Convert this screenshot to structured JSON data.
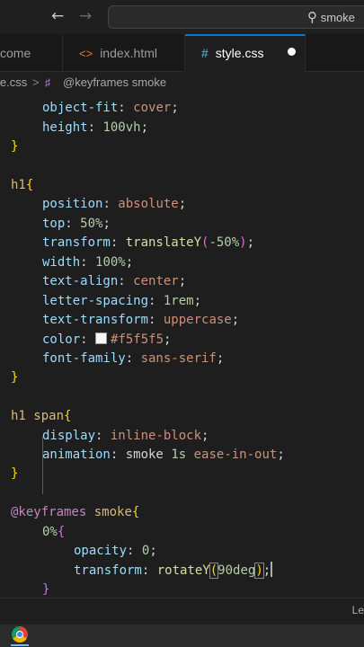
{
  "titlebar": {
    "search_text": "smoke"
  },
  "tabs": [
    {
      "label": "come"
    },
    {
      "label": "index.html",
      "icon": "html-file-icon"
    },
    {
      "label": "style.css",
      "icon": "css-file-icon",
      "active": true,
      "unsaved": true
    }
  ],
  "breadcrumb": {
    "file": "le.css",
    "separator": ">",
    "symbol": "@keyframes smoke"
  },
  "code": {
    "l1_prop": "object-fit",
    "l1_val": "cover",
    "l2_prop": "height",
    "l2_val": "100vh",
    "l5_sel": "h1",
    "l6_prop": "position",
    "l6_val": "absolute",
    "l7_prop": "top",
    "l7_val": "50%",
    "l8_prop": "transform",
    "l8_fn": "translateY",
    "l8_arg": "-50%",
    "l9_prop": "width",
    "l9_val": "100%",
    "l10_prop": "text-align",
    "l10_val": "center",
    "l11_prop": "letter-spacing",
    "l11_val": "1rem",
    "l12_prop": "text-transform",
    "l12_val": "uppercase",
    "l13_prop": "color",
    "l13_val": "#f5f5f5",
    "l14_prop": "font-family",
    "l14_val": "sans-serif",
    "l17_sel": "h1 span",
    "l18_prop": "display",
    "l18_val": "inline-block",
    "l19_prop": "animation",
    "l19_name": "smoke",
    "l19_dur": "1s",
    "l19_ease": "ease-in-out",
    "l22_at": "@keyframes",
    "l22_name": "smoke",
    "l23_stop": "0%",
    "l24_prop": "opacity",
    "l24_val": "0",
    "l25_prop": "transform",
    "l25_fn": "rotateY",
    "l25_arg": "90deg"
  },
  "panel": {
    "text": "Le"
  },
  "colors": {
    "accent": "#0078d4",
    "editor_bg": "#1e1e1e"
  }
}
